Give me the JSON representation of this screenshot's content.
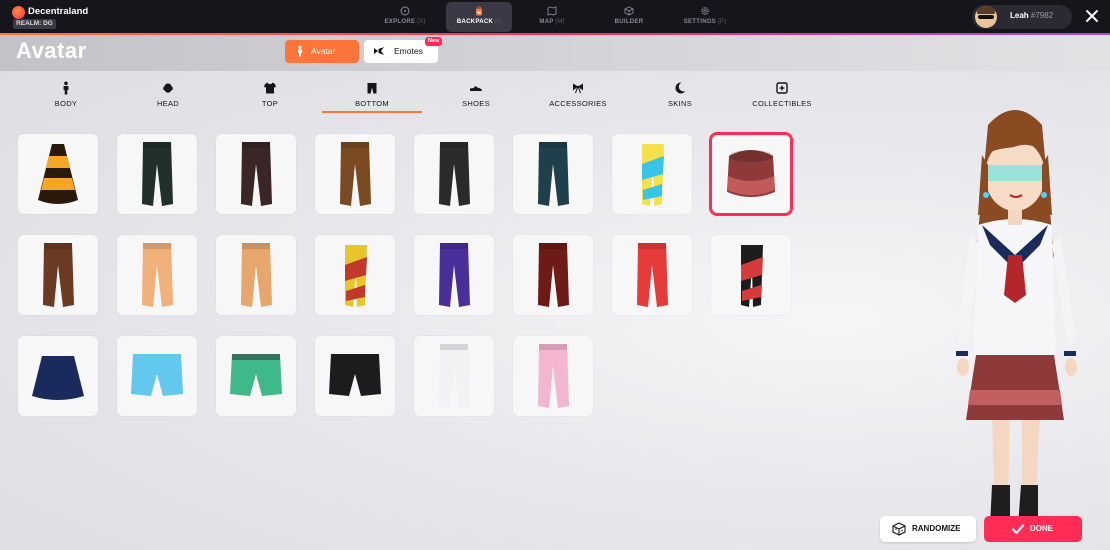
{
  "app": {
    "name": "Decentraland",
    "realm": "REALM: DG"
  },
  "nav": [
    {
      "label": "EXPLORE",
      "key": "[X]",
      "icon": "compass-icon",
      "active": false
    },
    {
      "label": "BACKPACK",
      "key": "[I]",
      "icon": "backpack-icon",
      "active": true
    },
    {
      "label": "MAP",
      "key": "[M]",
      "icon": "map-icon",
      "active": false
    },
    {
      "label": "BUILDER",
      "key": "",
      "icon": "cube-icon",
      "active": false
    },
    {
      "label": "SETTINGS",
      "key": "[P]",
      "icon": "gear-icon",
      "active": false
    }
  ],
  "user": {
    "name": "Leah",
    "tag": "#7982"
  },
  "page": {
    "title": "Avatar",
    "tabs": [
      {
        "label": "Avatar",
        "active": true
      },
      {
        "label": "Emotes",
        "active": false,
        "badge": "New"
      }
    ]
  },
  "categories": [
    {
      "label": "BODY",
      "icon": "body-icon"
    },
    {
      "label": "HEAD",
      "icon": "head-icon"
    },
    {
      "label": "TOP",
      "icon": "shirt-icon"
    },
    {
      "label": "BOTTOM",
      "icon": "pants-icon",
      "active": true
    },
    {
      "label": "SHOES",
      "icon": "shoe-icon"
    },
    {
      "label": "ACCESSORIES",
      "icon": "bow-icon"
    },
    {
      "label": "SKINS",
      "icon": "moon-icon"
    },
    {
      "label": "COLLECTIBLES",
      "icon": "collectible-icon"
    }
  ],
  "items": [
    {
      "name": "striped-cone-skirt",
      "shape": "cone",
      "colors": [
        "#2a1a0a",
        "#f5a623"
      ]
    },
    {
      "name": "dark-green-pants",
      "shape": "pants",
      "colors": [
        "#213028"
      ]
    },
    {
      "name": "dark-brown-pants",
      "shape": "pants",
      "colors": [
        "#3a2626"
      ]
    },
    {
      "name": "brown-pants",
      "shape": "pants",
      "colors": [
        "#7a4a22"
      ]
    },
    {
      "name": "ripped-black-jeans",
      "shape": "pants",
      "colors": [
        "#2b2b2b"
      ]
    },
    {
      "name": "teal-pants",
      "shape": "pants",
      "colors": [
        "#1f3f4a"
      ]
    },
    {
      "name": "pattern-leggings",
      "shape": "leggings",
      "colors": [
        "#f4e04d",
        "#36c5e8"
      ]
    },
    {
      "name": "maroon-skirt",
      "shape": "skirt-cylinder",
      "colors": [
        "#8e3a3a",
        "#c25a5a"
      ],
      "selected": true
    },
    {
      "name": "brown-cargo-pants",
      "shape": "pants",
      "colors": [
        "#6b3a22"
      ]
    },
    {
      "name": "peach-pants",
      "shape": "pants",
      "colors": [
        "#f0b07a"
      ]
    },
    {
      "name": "tan-pants",
      "shape": "pants",
      "colors": [
        "#e6a66c"
      ]
    },
    {
      "name": "harlequin-leggings",
      "shape": "leggings",
      "colors": [
        "#e8c52a",
        "#c0392b"
      ]
    },
    {
      "name": "purple-pants",
      "shape": "pants",
      "colors": [
        "#4a2f9a"
      ]
    },
    {
      "name": "dark-red-pants",
      "shape": "pants",
      "colors": [
        "#6e1a16"
      ]
    },
    {
      "name": "red-black-pants",
      "shape": "pants",
      "colors": [
        "#e63b3b",
        "#1d1d1d"
      ]
    },
    {
      "name": "black-red-leggings",
      "shape": "leggings",
      "colors": [
        "#1d1d1d",
        "#d63a3a"
      ]
    },
    {
      "name": "navy-skirt",
      "shape": "skirt",
      "colors": [
        "#1b2a5c"
      ]
    },
    {
      "name": "sky-blue-shorts",
      "shape": "shorts",
      "colors": [
        "#62c8ee"
      ]
    },
    {
      "name": "floral-shorts",
      "shape": "shorts",
      "colors": [
        "#3fb98a",
        "#2b2b2b"
      ]
    },
    {
      "name": "black-shorts",
      "shape": "shorts",
      "colors": [
        "#1c1c1e"
      ]
    },
    {
      "name": "white-track-pants",
      "shape": "pants",
      "colors": [
        "#f2f2f4"
      ]
    },
    {
      "name": "pink-flare-pants",
      "shape": "pants",
      "colors": [
        "#f2b6d0"
      ]
    }
  ],
  "actions": {
    "randomize": "RANDOMIZE",
    "done": "DONE"
  },
  "colors": {
    "accent": "#ff7439",
    "primary": "#ff2d55",
    "topbar": "#16151c"
  }
}
